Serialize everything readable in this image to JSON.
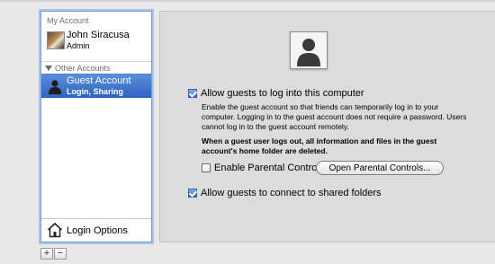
{
  "sidebar": {
    "my_account_header": "My Account",
    "user": {
      "name": "John Siracusa",
      "role": "Admin"
    },
    "other_accounts_header": "Other Accounts",
    "guest": {
      "name": "Guest Account",
      "detail": "Login, Sharing"
    },
    "login_options": "Login Options"
  },
  "buttons": {
    "add": "+",
    "remove": "−"
  },
  "guest_panel": {
    "allow_login_label": "Allow guests to log into this computer",
    "allow_login_description": "Enable the guest account so that friends can temporarily log in to your computer. Logging in to the guest account does not require a password. Users cannot log in to the guest account remotely.",
    "logout_warning": "When a guest user logs out, all information and files in the guest account's home folder are deleted.",
    "parental_controls_label": "Enable Parental Controls",
    "open_parental_controls_button": "Open Parental Controls...",
    "allow_shared_folders_label": "Allow guests to connect to shared folders"
  },
  "state": {
    "allow_login_checked": true,
    "parental_controls_checked": false,
    "allow_shared_checked": true
  },
  "colors": {
    "selection": "#2f62c0",
    "panel_bg": "#dcdcdc",
    "window_bg": "#e8e8e8"
  }
}
